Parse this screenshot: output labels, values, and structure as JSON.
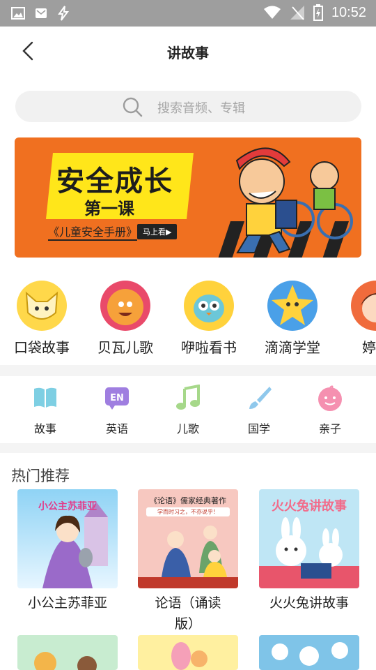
{
  "status_bar": {
    "time": "10:52",
    "icons": [
      "image-icon",
      "email-icon",
      "lightning-icon",
      "wifi-icon",
      "no-signal-icon",
      "battery-charging-icon"
    ]
  },
  "app_bar": {
    "title": "讲故事",
    "back_icon": "chevron-left-icon"
  },
  "search": {
    "placeholder": "搜索音频、专辑"
  },
  "banner": {
    "headline": "安全成长",
    "subheadline": "第一课",
    "book": "《儿童安全手册》",
    "cta": "马上看▶",
    "colors": {
      "background": "#f07020",
      "highlight": "#ffe61a"
    }
  },
  "channels": [
    {
      "label": "口袋故事",
      "color": "#ffd84a"
    },
    {
      "label": "贝瓦儿歌",
      "color": "#e94a6a"
    },
    {
      "label": "咿啦看书",
      "color": "#ffd23c"
    },
    {
      "label": "滴滴学堂",
      "color": "#4aa0e8"
    },
    {
      "label": "婷婷",
      "color": "#f06b3c"
    }
  ],
  "categories": [
    {
      "label": "故事",
      "icon": "book-icon",
      "color": "#7ecfe3"
    },
    {
      "label": "英语",
      "icon": "en-badge-icon",
      "color": "#9f7ee0"
    },
    {
      "label": "儿歌",
      "icon": "music-note-icon",
      "color": "#a6d88a"
    },
    {
      "label": "国学",
      "icon": "brush-icon",
      "color": "#8fc8ec"
    },
    {
      "label": "亲子",
      "icon": "smiley-icon",
      "color": "#f590b0"
    }
  ],
  "hot": {
    "title": "热门推荐",
    "items": [
      {
        "name": "小公主苏菲亚",
        "cover_text": "小公主苏菲亚"
      },
      {
        "name": "论语（诵读版）",
        "name_line1": "论语（诵读",
        "name_line2": "版）",
        "cover_text": "《论语》儒家经典著作",
        "cover_sub": "学而时习之，不亦说乎！"
      },
      {
        "name": "火火兔讲故事",
        "cover_text": "火火兔讲故事"
      }
    ]
  }
}
